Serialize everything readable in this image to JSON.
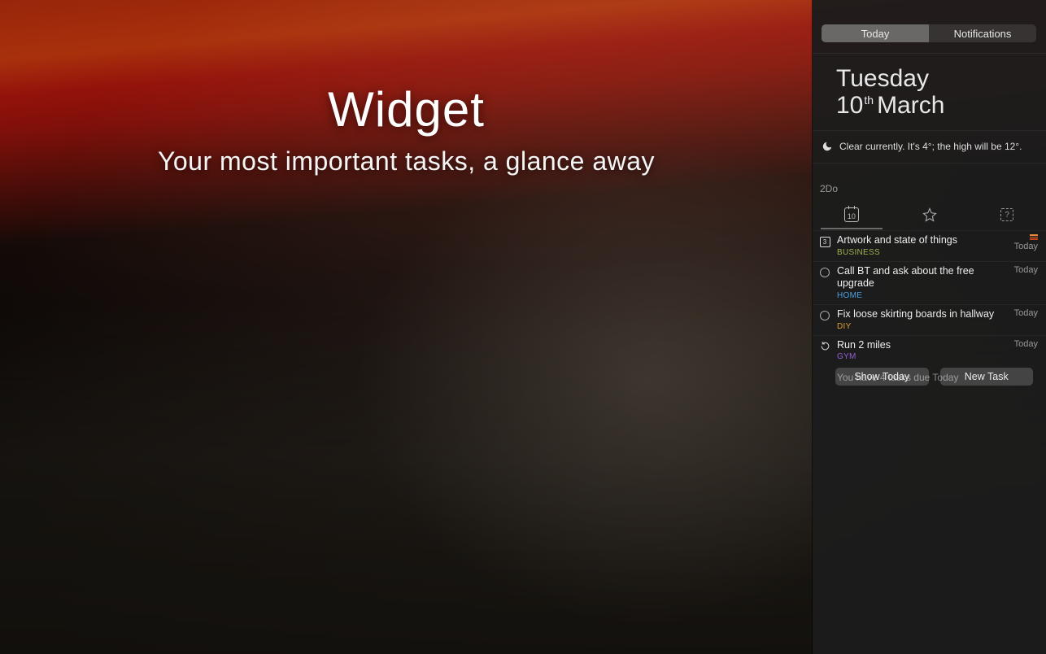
{
  "hero": {
    "title": "Widget",
    "subtitle": "Your most important tasks, a glance away"
  },
  "nc": {
    "tabs": {
      "today": "Today",
      "notifications": "Notifications"
    },
    "date": {
      "dow": "Tuesday",
      "day": "10",
      "ord": "th",
      "month": "March"
    },
    "weather": {
      "text": "Clear currently. It's 4°; the high will be 12°."
    },
    "app": "2Do",
    "widget_tabs": {
      "calendar_day": "10",
      "help": "?"
    },
    "tasks": [
      {
        "icon": "subtasks",
        "icon_value": "3",
        "title": "Artwork and state of things",
        "tag": "BUSINESS",
        "tag_color": "#a0b050",
        "due": "Today",
        "flag": true
      },
      {
        "icon": "circle",
        "title": "Call BT and ask about the free upgrade",
        "tag": "HOME",
        "tag_color": "#4aa0e0",
        "due": "Today",
        "flag": false
      },
      {
        "icon": "circle",
        "title": "Fix loose skirting boards in hallway",
        "tag": "DIY",
        "tag_color": "#d8a030",
        "due": "Today",
        "flag": false
      },
      {
        "icon": "repeat",
        "title": "Run 2 miles",
        "tag": "GYM",
        "tag_color": "#9060d0",
        "due": "Today",
        "flag": false
      }
    ],
    "summary": "You have 4 tasks due Today",
    "buttons": {
      "show": "Show Today",
      "new": "New Task"
    }
  }
}
